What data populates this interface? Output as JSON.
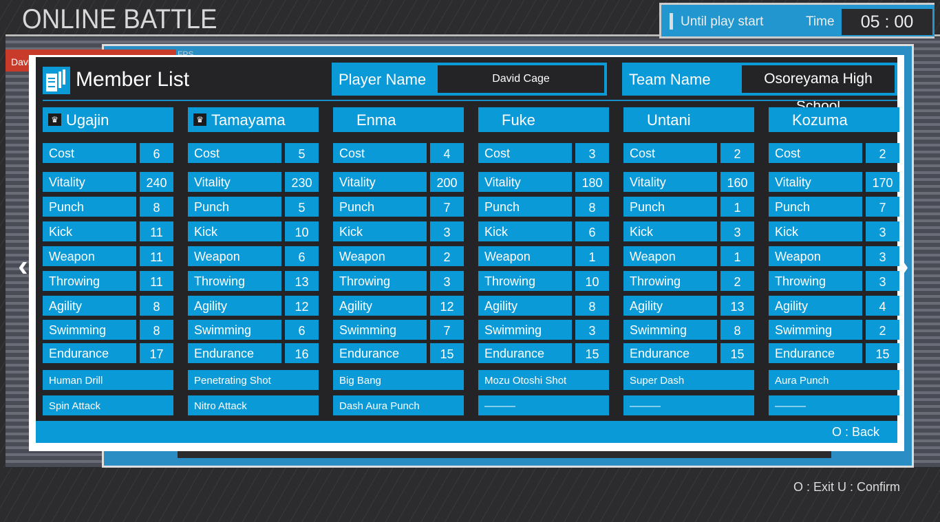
{
  "screen_title": "ONLINE BATTLE",
  "background": {
    "player_tab": "Davi",
    "fps_label": "FPS"
  },
  "timer": {
    "label": "Until play start",
    "time_label": "Time",
    "time_value": "05 : 00"
  },
  "hint": "O : Exit  U : Confirm",
  "panel": {
    "title": "Member List",
    "player_name_label": "Player Name",
    "player_name": "David Cage",
    "team_name_label": "Team Name",
    "team_name": "Osoreyama High School",
    "back_label": "O : Back",
    "stat_labels": [
      "Cost",
      "Vitality",
      "Punch",
      "Kick",
      "Weapon",
      "Throwing",
      "Agility",
      "Swimming",
      "Endurance"
    ],
    "members": [
      {
        "name": "Ugajin",
        "captain_icon": "crown-icon",
        "stats": [
          "6",
          "240",
          "8",
          "11",
          "11",
          "11",
          "8",
          "8",
          "17"
        ],
        "skills": [
          "Human Drill",
          "Spin Attack"
        ]
      },
      {
        "name": "Tamayama",
        "captain_icon": "crown-icon",
        "stats": [
          "5",
          "230",
          "5",
          "10",
          "6",
          "13",
          "12",
          "6",
          "16"
        ],
        "skills": [
          "Penetrating Shot",
          "Nitro Attack"
        ]
      },
      {
        "name": "Enma",
        "stats": [
          "4",
          "200",
          "7",
          "3",
          "2",
          "3",
          "12",
          "7",
          "15"
        ],
        "skills": [
          "Big Bang",
          "Dash Aura Punch"
        ]
      },
      {
        "name": "Fuke",
        "stats": [
          "3",
          "180",
          "8",
          "6",
          "1",
          "10",
          "8",
          "3",
          "15"
        ],
        "skills": [
          "Mozu Otoshi Shot",
          "———"
        ]
      },
      {
        "name": "Untani",
        "stats": [
          "2",
          "160",
          "1",
          "3",
          "1",
          "2",
          "13",
          "8",
          "15"
        ],
        "skills": [
          "Super Dash",
          "———"
        ]
      },
      {
        "name": "Kozuma",
        "stats": [
          "2",
          "170",
          "7",
          "3",
          "3",
          "3",
          "4",
          "2",
          "15"
        ],
        "skills": [
          "Aura Punch",
          "———"
        ]
      }
    ]
  },
  "colors": {
    "accent": "#0a9ad8",
    "panel_bg": "#242426"
  }
}
